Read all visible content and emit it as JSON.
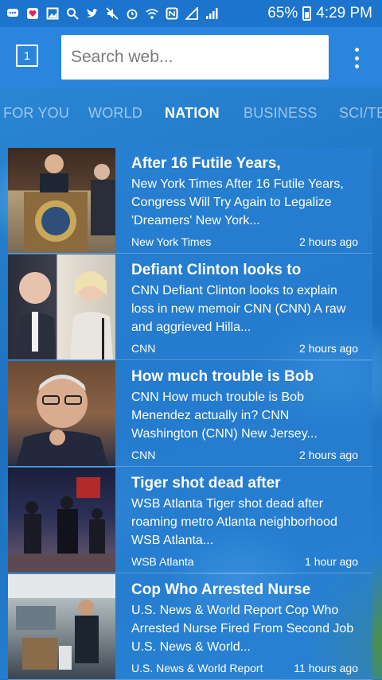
{
  "status_bar": {
    "battery_percent": "65%",
    "time": "4:29 PM",
    "icons": [
      "messages-icon",
      "heart-icon",
      "gallery-icon",
      "search-icon",
      "twitter-icon",
      "mute-icon",
      "alarm-icon",
      "wifi-icon",
      "nfc-icon",
      "signal-icon",
      "signal-bars-icon",
      "battery-charging-icon"
    ]
  },
  "header": {
    "tab_count": "1",
    "search_placeholder": "Search web..."
  },
  "categories": {
    "items": [
      "FOR YOU",
      "WORLD",
      "NATION",
      "BUSINESS",
      "SCI/TE"
    ],
    "active": "NATION"
  },
  "feed": {
    "articles": [
      {
        "title": "After 16 Futile Years,",
        "snippet": "New York Times After 16 Futile Years, Congress Will Try Again to Legalize 'Dreamers' New York...",
        "source": "New York Times",
        "time": "2 hours ago"
      },
      {
        "title": "Defiant Clinton looks to",
        "snippet": "CNN Defiant Clinton looks to explain loss in new memoir CNN (CNN) A raw and aggrieved Hilla...",
        "source": "CNN",
        "time": "2 hours ago"
      },
      {
        "title": "How much trouble is Bob",
        "snippet": "CNN How much trouble is Bob Menendez actually in? CNN Washington (CNN) New Jersey...",
        "source": "CNN",
        "time": "2 hours ago"
      },
      {
        "title": "Tiger shot dead after",
        "snippet": "WSB Atlanta Tiger shot dead after roaming metro Atlanta neighborhood WSB Atlanta...",
        "source": "WSB Atlanta",
        "time": "1 hour ago"
      },
      {
        "title": "Cop Who Arrested Nurse",
        "snippet": "U.S. News & World Report Cop Who Arrested Nurse Fired From Second Job U.S. News & World...",
        "source": "U.S. News & World Report",
        "time": "11 hours ago"
      }
    ]
  }
}
